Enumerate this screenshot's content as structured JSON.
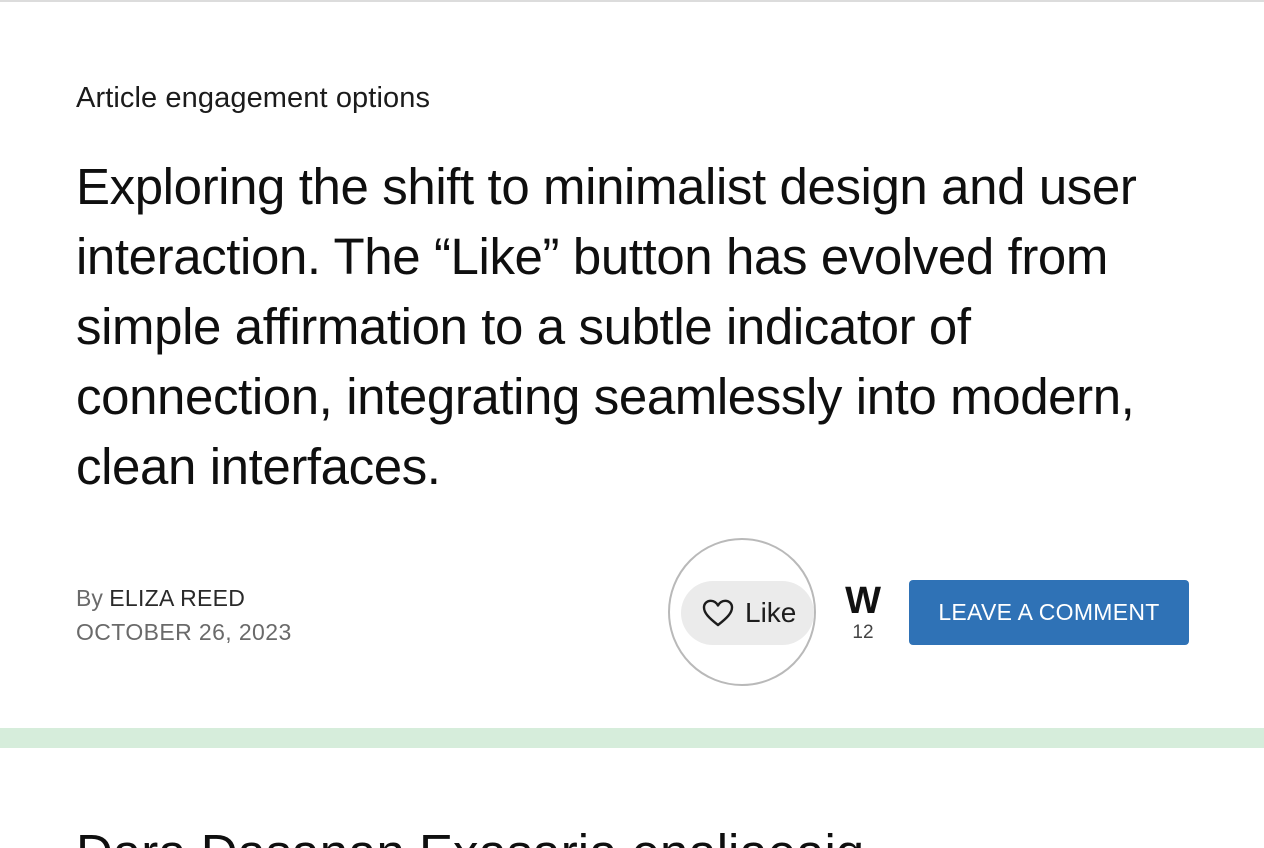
{
  "article": {
    "eyebrow": "Article engagement options",
    "headline": "Exploring the shift to minimalist design and user interaction. The “Like” button has evolved from simple affirmation to a subtle indicator of connection, integrating seamlessly into modern, clean interfaces.",
    "byline_prefix": "By",
    "author": "ELIZA REED",
    "date": "OCTOBER 26, 2023"
  },
  "engagement": {
    "like_label": "Like",
    "like_icon": "heart-outline-icon",
    "wp_letter": "W",
    "wp_count": "12",
    "comment_label": "LEAVE A COMMENT"
  },
  "next_article": {
    "headline_partial": "Dara Dasanan Exasaria enaliaeaiq"
  },
  "colors": {
    "comment_button": "#2f72b6",
    "divider": "#d6eddb",
    "like_button_bg": "#ebebeb"
  }
}
